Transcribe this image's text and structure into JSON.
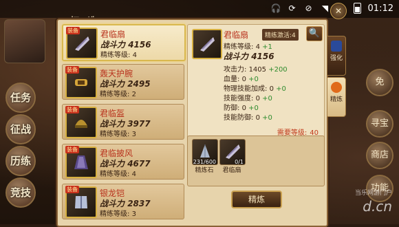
{
  "status_bar": {
    "time": "01:12"
  },
  "title": "打 造",
  "hud_left": [
    {
      "label": "任务"
    },
    {
      "label": "征战"
    },
    {
      "label": "历练"
    },
    {
      "label": "竞技"
    }
  ],
  "hud_right": [
    {
      "label": "免"
    },
    {
      "label": "寻宝"
    },
    {
      "label": "商店"
    },
    {
      "label": "功能"
    }
  ],
  "item_list": [
    {
      "name": "君临扇",
      "power_label": "战斗力",
      "power": "4156",
      "level_label": "精练等级:",
      "level": "4",
      "tag": "装备",
      "selected": true
    },
    {
      "name": "轰天护腕",
      "power_label": "战斗力",
      "power": "2495",
      "level_label": "精练等级:",
      "level": "2",
      "tag": "装备",
      "selected": false
    },
    {
      "name": "君临盔",
      "power_label": "战斗力",
      "power": "3977",
      "level_label": "精练等级:",
      "level": "3",
      "tag": "装备",
      "selected": false
    },
    {
      "name": "君临披风",
      "power_label": "战斗力",
      "power": "4677",
      "level_label": "精练等级:",
      "level": "4",
      "tag": "装备",
      "selected": false
    },
    {
      "name": "银龙铠",
      "power_label": "战斗力",
      "power": "2837",
      "level_label": "精练等级:",
      "level": "3",
      "tag": "装备",
      "selected": false
    }
  ],
  "detail": {
    "name": "君临扇",
    "refine_badge": "精练激活:4",
    "refine_level_label": "精练等级:",
    "refine_level": "4",
    "refine_level_inc": "+1",
    "power_label": "战斗力",
    "power": "4156",
    "stats": [
      {
        "label": "攻击力:",
        "value": "1405",
        "inc": "+200"
      },
      {
        "label": "血量:",
        "value": "0",
        "inc": "+0"
      },
      {
        "label": "物理技能加成:",
        "value": "0",
        "inc": "+0"
      },
      {
        "label": "技能强度:",
        "value": "0",
        "inc": "+0"
      },
      {
        "label": "防御:",
        "value": "0",
        "inc": "+0"
      },
      {
        "label": "技能防御:",
        "value": "0",
        "inc": "+0"
      }
    ],
    "requirement_label": "需要等级:",
    "requirement_value": "40"
  },
  "materials": [
    {
      "label": "精炼石",
      "count": "231/600"
    },
    {
      "label": "君临扇",
      "count": "0/1"
    }
  ],
  "refine_button": "精炼",
  "tabs": [
    {
      "label": "强化"
    },
    {
      "label": "精炼"
    }
  ],
  "watermark": {
    "sub": "当乐网游门户",
    "main": "d.cn"
  }
}
